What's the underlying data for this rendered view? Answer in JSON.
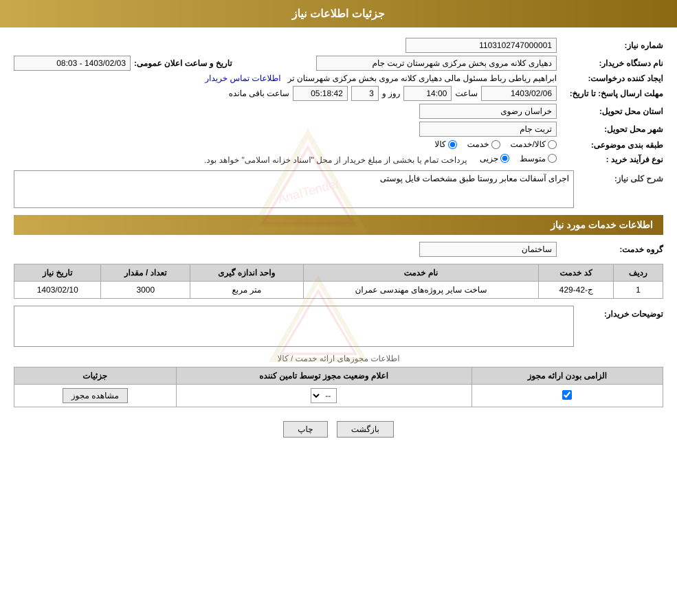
{
  "page": {
    "title": "جزئیات اطلاعات نیاز",
    "header": {
      "label": "جزئیات اطلاعات نیاز"
    }
  },
  "fields": {
    "need_number_label": "شماره نیاز:",
    "need_number_value": "1103102747000001",
    "buyer_label": "نام دستگاه خریدار:",
    "buyer_value": "دهیاری کلانه مروی بخش مرکزی شهرستان تربت جام",
    "requester_label": "ایجاد کننده درخواست:",
    "requester_name": "ابراهیم ریاطی رباط مسئول مالی دهیاری کلانه مروی بخش مرکزی شهرستان تر",
    "requester_link": "اطلاعات تماس خریدار",
    "announce_date_label": "تاریخ و ساعت اعلان عمومی:",
    "announce_date_value": "1403/02/03 - 08:03",
    "response_deadline_label": "مهلت ارسال پاسخ: تا تاریخ:",
    "response_date": "1403/02/06",
    "response_time": "14:00",
    "response_days": "3",
    "response_remaining": "05:18:42",
    "day_label": "روز و",
    "time_label": "ساعت",
    "remaining_label": "ساعت باقی مانده",
    "province_label": "استان محل تحویل:",
    "province_value": "خراسان رضوی",
    "city_label": "شهر محل تحویل:",
    "city_value": "تربت جام",
    "category_label": "طبقه بندی موضوعی:",
    "category_kala": "کالا",
    "category_khadamat": "خدمت",
    "category_kala_khadamat": "کالا/خدمت",
    "purchase_type_label": "نوع فرآیند خرید :",
    "purchase_jozyi": "جزیی",
    "purchase_motavaset": "متوسط",
    "purchase_description": "پرداخت تمام یا بخشی از مبلغ خریدار از محل \"اسناد خزانه اسلامی\" خواهد بود.",
    "need_desc_label": "شرح کلی نیاز:",
    "need_desc_value": "اجرای آسفالت معابر روستا طبق مشخصات فایل پوستی",
    "services_section_label": "اطلاعات خدمات مورد نیاز",
    "service_group_label": "گروه خدمت:",
    "service_group_value": "ساختمان",
    "table_headers": {
      "row_num": "ردیف",
      "service_code": "کد خدمت",
      "service_name": "نام خدمت",
      "unit_measure": "واحد اندازه گیری",
      "quantity": "تعداد / مقدار",
      "need_date": "تاریخ نیاز"
    },
    "table_rows": [
      {
        "row": "1",
        "code": "ج-42-429",
        "name": "ساخت سایر پروژه‌های مهندسی عمران",
        "unit": "متر مربع",
        "quantity": "3000",
        "date": "1403/02/10"
      }
    ],
    "buyer_notes_label": "توضیحات خریدار:",
    "buyer_notes_value": "",
    "licenses_title": "اطلاعات مجوزهای ارائه خدمت / کالا",
    "licenses_table_headers": {
      "required": "الزامی بودن ارائه مجوز",
      "supplier_status": "اعلام وضعیت مجوز توسط تامین کننده",
      "details": "جزئیات"
    },
    "licenses_rows": [
      {
        "required": true,
        "supplier_status": "--",
        "details": "مشاهده مجوز"
      }
    ],
    "btn_back": "بازگشت",
    "btn_print": "چاپ"
  }
}
